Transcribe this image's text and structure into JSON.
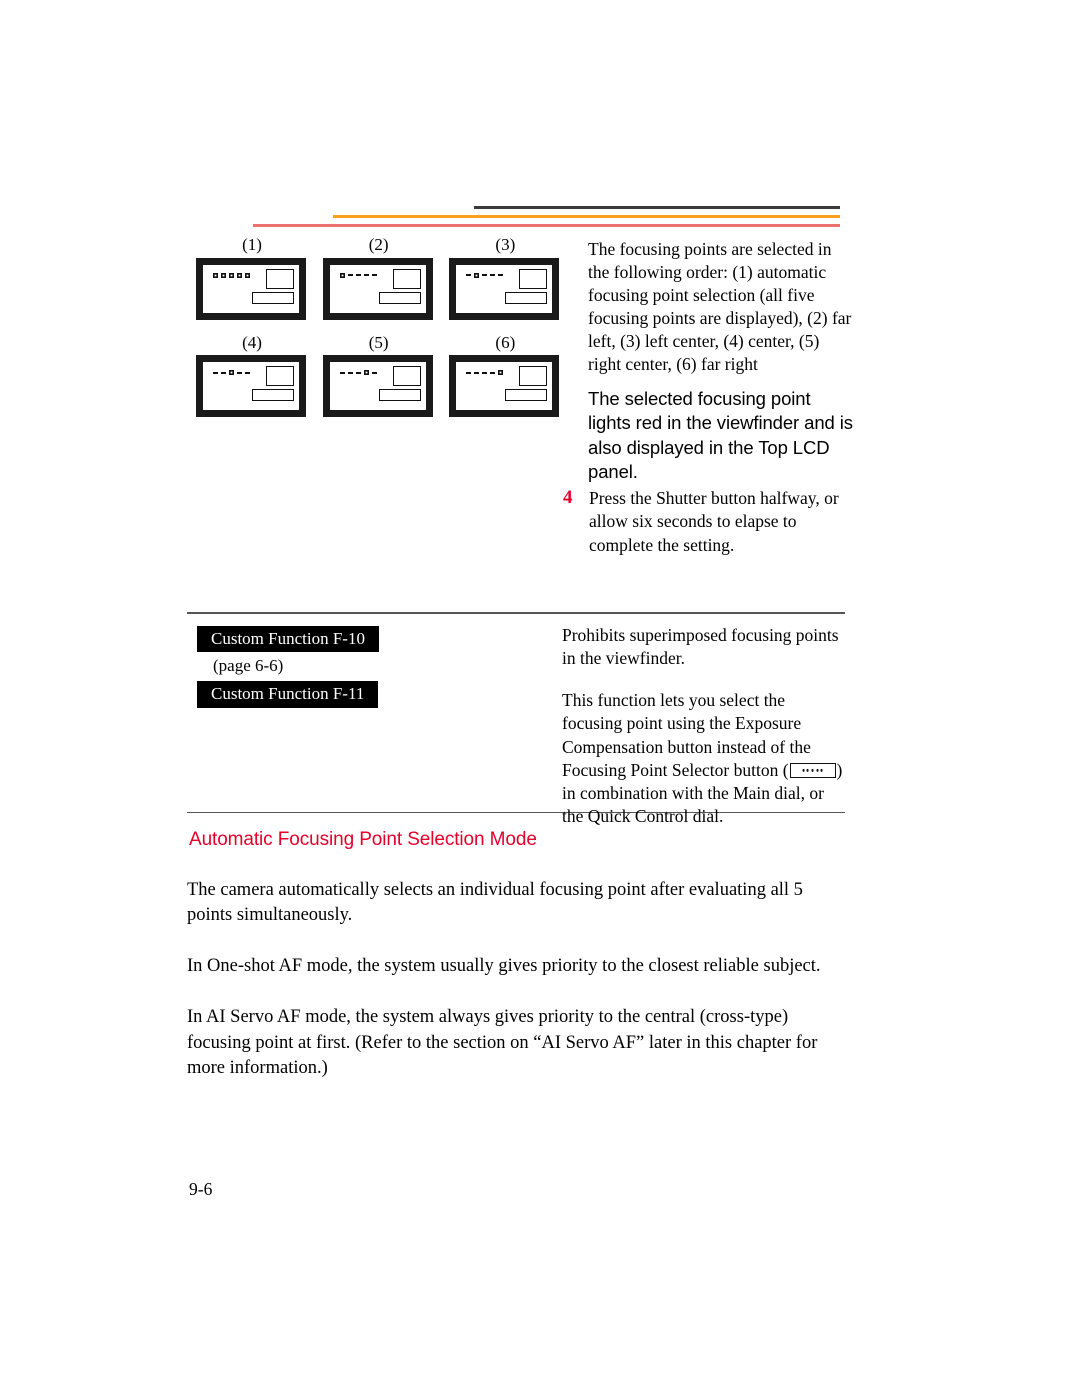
{
  "page": {
    "number": "9-6"
  },
  "header_rules": {
    "black": "#3a3a3a",
    "orange": "#f9a11b",
    "red": "#e8736e"
  },
  "colors": {
    "accent_red": "#e4002b",
    "rule_orange": "#f9a11b",
    "rule_red": "#e8736e",
    "rule_black": "#3a3a3a"
  },
  "figure": {
    "panels": [
      {
        "caption": "(1)",
        "pattern": [
          "on",
          "on",
          "on",
          "on",
          "on"
        ]
      },
      {
        "caption": "(2)",
        "pattern": [
          "on",
          "dash",
          "dash",
          "dash",
          "dash"
        ]
      },
      {
        "caption": "(3)",
        "pattern": [
          "dash",
          "on",
          "dash",
          "dash",
          "dash"
        ]
      },
      {
        "caption": "(4)",
        "pattern": [
          "dash",
          "dash",
          "on",
          "dash",
          "dash"
        ]
      },
      {
        "caption": "(5)",
        "pattern": [
          "dash",
          "dash",
          "dash",
          "on",
          "dash"
        ]
      },
      {
        "caption": "(6)",
        "pattern": [
          "dash",
          "dash",
          "dash",
          "dash",
          "on"
        ]
      }
    ]
  },
  "step_column": {
    "order_paragraph": "The focusing points are selected in the following order: (1) automatic focusing point selection (all five focusing points are displayed), (2) far left, (3) left center, (4) center,     (5) right center, (6) far right",
    "callout": "The selected focusing point lights red in the viewfinder and is also displayed in the Top LCD panel."
  },
  "step_4": {
    "number": "4",
    "text": "Press the Shutter button halfway, or allow six seconds to elapse to complete the setting."
  },
  "custom_functions": {
    "f10_label": "Custom Function F-10",
    "page_ref": "(page 6-6)",
    "f11_label": "Custom Function F-11",
    "f10_description": "Prohibits superimposed focusing points in the viewfinder.",
    "f11_description_before_icon": "This function lets you select the focusing point using the Exposure Compensation button instead of the Focusing Point Selector button (",
    "f11_description_after_icon": ") in combination with the Main dial, or the Quick Control dial."
  },
  "section": {
    "heading": "Automatic Focusing Point Selection Mode",
    "paragraphs": [
      "The camera automatically selects an individual focusing point after evaluating all 5 points simultaneously.",
      "In One-shot AF mode, the system usually gives priority to the closest reliable subject.",
      "In AI Servo AF mode, the system always gives priority to the central (cross-type) focusing point at first. (Refer to the section on “AI Servo AF” later in this chapter for more information.)"
    ]
  }
}
